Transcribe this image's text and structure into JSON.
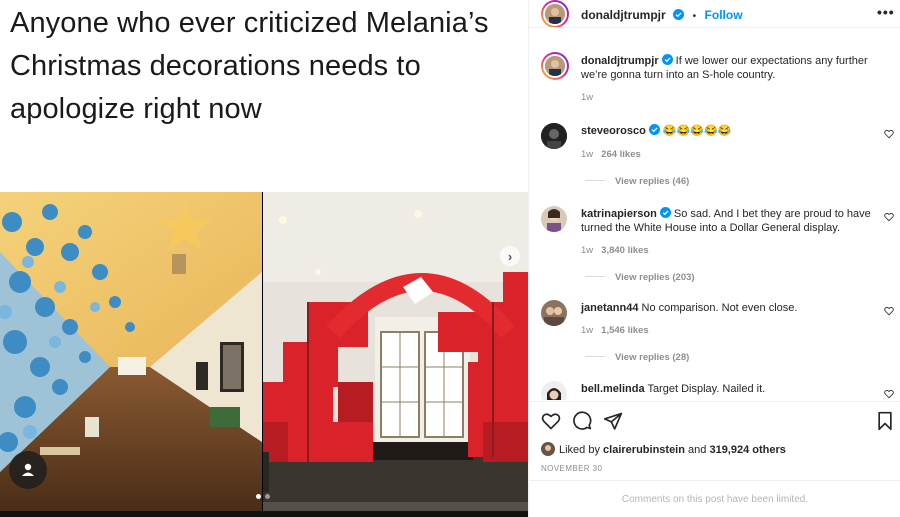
{
  "meme": {
    "caption_line1": "Anyone who ever criticized Melania’s",
    "caption_line2": "Christmas decorations needs to",
    "caption_line3": "apologize right now"
  },
  "carousel": {
    "slide_count": 2,
    "active_slide": 1
  },
  "header": {
    "username": "donaldjtrumpjr",
    "separator": "•",
    "follow_label": "Follow",
    "more_icon": "more-dots-icon"
  },
  "caption": {
    "username": "donaldjtrumpjr",
    "text": "If we lower our expectations any further we’re gonna turn into an S-hole country.",
    "time": "1w"
  },
  "comments": [
    {
      "username": "steveorosco",
      "verified": true,
      "text": "😂😂😂😂😂",
      "time": "1w",
      "likes": "264 likes",
      "replies": "View replies (46)"
    },
    {
      "username": "katrinapierson",
      "verified": true,
      "text": "So sad. And I bet they are proud to have turned the White House into a Dollar General display.",
      "time": "1w",
      "likes": "3,840 likes",
      "replies": "View replies (203)"
    },
    {
      "username": "janetann44",
      "verified": false,
      "text": "No comparison. Not even close.",
      "time": "1w",
      "likes": "1,546 likes",
      "replies": "View replies (28)"
    },
    {
      "username": "bell.melinda",
      "verified": false,
      "text": "Target Display. Nailed it."
    }
  ],
  "likes": {
    "prefix": "Liked by",
    "user": "clairerubinstein",
    "conjunction": "and",
    "others": "319,924 others"
  },
  "date": "NOVEMBER 30",
  "comments_limited": "Comments on this post have been limited.",
  "colors": {
    "accent": "#0095f6",
    "text": "#262626",
    "muted": "#8e8e8e",
    "gift_red": "#d9222a"
  }
}
